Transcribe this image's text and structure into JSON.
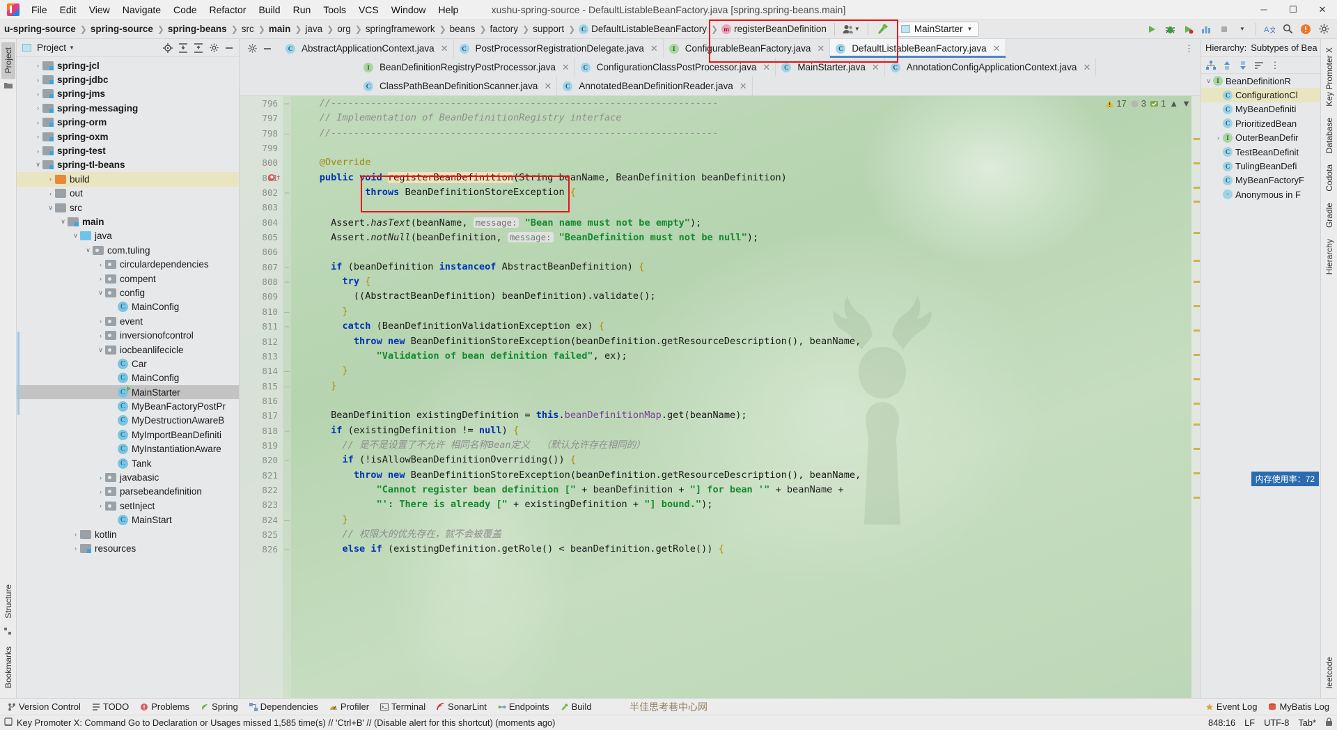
{
  "window": {
    "title": "xushu-spring-source - DefaultListableBeanFactory.java [spring.spring-beans.main]",
    "minimize": "─",
    "maximize": "☐",
    "close": "✕"
  },
  "menubar": [
    {
      "label": "File"
    },
    {
      "label": "Edit"
    },
    {
      "label": "View"
    },
    {
      "label": "Navigate"
    },
    {
      "label": "Code"
    },
    {
      "label": "Refactor"
    },
    {
      "label": "Build"
    },
    {
      "label": "Run"
    },
    {
      "label": "Tools"
    },
    {
      "label": "VCS"
    },
    {
      "label": "Window"
    },
    {
      "label": "Help"
    }
  ],
  "breadcrumbs": [
    {
      "label": "u-spring-source",
      "bold": true,
      "icon": null
    },
    {
      "label": "spring-source",
      "bold": true,
      "icon": null
    },
    {
      "label": "spring-beans",
      "bold": true,
      "icon": null
    },
    {
      "label": "src",
      "bold": false,
      "icon": null
    },
    {
      "label": "main",
      "bold": true,
      "icon": null
    },
    {
      "label": "java",
      "bold": false,
      "icon": null
    },
    {
      "label": "org",
      "bold": false,
      "icon": null
    },
    {
      "label": "springframework",
      "bold": false,
      "icon": null
    },
    {
      "label": "beans",
      "bold": false,
      "icon": null
    },
    {
      "label": "factory",
      "bold": false,
      "icon": null
    },
    {
      "label": "support",
      "bold": false,
      "icon": null
    },
    {
      "label": "DefaultListableBeanFactory",
      "bold": false,
      "icon": "class-icon",
      "iconletter": "C"
    },
    {
      "label": "registerBeanDefinition",
      "bold": false,
      "icon": "method-icon",
      "iconletter": "m"
    }
  ],
  "toolbar": {
    "avatar_icon": "user-group-icon",
    "hammer_icon": "build-hammer-icon",
    "run_config": "MainStarter",
    "run_icon": "run-config-icon",
    "right_icons": [
      "run-icon",
      "debug-icon",
      "coverage-icon",
      "profile-icon",
      "more-icon",
      "translate-icon",
      "search-icon",
      "updates-icon",
      "settings-icon"
    ]
  },
  "project_panel": {
    "tool_title": "Project",
    "vertical_tabs": [
      "Project",
      "Bookmarks",
      "Structure"
    ],
    "header_actions": [
      "locate-icon",
      "expand-all-icon",
      "collapse-all-icon",
      "settings-icon",
      "hide-icon"
    ],
    "tree": [
      {
        "depth": 1,
        "arrow": "›",
        "icon": "module-folder-icon",
        "label": "spring-jcl",
        "bold": true,
        "state": "none"
      },
      {
        "depth": 1,
        "arrow": "›",
        "icon": "module-folder-icon",
        "label": "spring-jdbc",
        "bold": true,
        "state": "none"
      },
      {
        "depth": 1,
        "arrow": "›",
        "icon": "module-folder-icon",
        "label": "spring-jms",
        "bold": true,
        "state": "none"
      },
      {
        "depth": 1,
        "arrow": "›",
        "icon": "module-folder-icon",
        "label": "spring-messaging",
        "bold": true,
        "state": "none"
      },
      {
        "depth": 1,
        "arrow": "›",
        "icon": "module-folder-icon",
        "label": "spring-orm",
        "bold": true,
        "state": "none"
      },
      {
        "depth": 1,
        "arrow": "›",
        "icon": "module-folder-icon",
        "label": "spring-oxm",
        "bold": true,
        "state": "none"
      },
      {
        "depth": 1,
        "arrow": "›",
        "icon": "module-folder-icon",
        "label": "spring-test",
        "bold": true,
        "state": "none"
      },
      {
        "depth": 1,
        "arrow": "∨",
        "icon": "module-folder-icon",
        "label": "spring-tl-beans",
        "bold": true,
        "state": "none"
      },
      {
        "depth": 2,
        "arrow": "›",
        "icon": "excluded-folder-icon",
        "label": "build",
        "bold": false,
        "state": "highlight"
      },
      {
        "depth": 2,
        "arrow": "›",
        "icon": "folder-icon",
        "label": "out",
        "bold": false,
        "state": "none"
      },
      {
        "depth": 2,
        "arrow": "∨",
        "icon": "folder-icon",
        "label": "src",
        "bold": false,
        "state": "none"
      },
      {
        "depth": 3,
        "arrow": "∨",
        "icon": "module-folder-icon",
        "label": "main",
        "bold": true,
        "state": "none"
      },
      {
        "depth": 4,
        "arrow": "∨",
        "icon": "source-folder-icon",
        "label": "java",
        "bold": false,
        "state": "none"
      },
      {
        "depth": 5,
        "arrow": "∨",
        "icon": "package-icon",
        "label": "com.tuling",
        "bold": false,
        "state": "none"
      },
      {
        "depth": 6,
        "arrow": "›",
        "icon": "package-icon",
        "label": "circulardependencies",
        "bold": false,
        "state": "none"
      },
      {
        "depth": 6,
        "arrow": "›",
        "icon": "package-icon",
        "label": "compent",
        "bold": false,
        "state": "none"
      },
      {
        "depth": 6,
        "arrow": "∨",
        "icon": "package-icon",
        "label": "config",
        "bold": false,
        "state": "none"
      },
      {
        "depth": 7,
        "arrow": "",
        "icon": "java-class-icon",
        "label": "MainConfig",
        "bold": false,
        "state": "none"
      },
      {
        "depth": 6,
        "arrow": "›",
        "icon": "package-icon",
        "label": "event",
        "bold": false,
        "state": "none"
      },
      {
        "depth": 6,
        "arrow": "›",
        "icon": "package-icon",
        "label": "inversionofcontrol",
        "bold": false,
        "state": "none"
      },
      {
        "depth": 6,
        "arrow": "∨",
        "icon": "package-icon",
        "label": "iocbeanlifecicle",
        "bold": false,
        "state": "none"
      },
      {
        "depth": 7,
        "arrow": "",
        "icon": "java-class-icon",
        "label": "Car",
        "bold": false,
        "state": "none"
      },
      {
        "depth": 7,
        "arrow": "",
        "icon": "java-class-icon",
        "label": "MainConfig",
        "bold": false,
        "state": "none"
      },
      {
        "depth": 7,
        "arrow": "",
        "icon": "java-runnable-class-icon",
        "label": "MainStarter",
        "bold": false,
        "state": "selected"
      },
      {
        "depth": 7,
        "arrow": "",
        "icon": "java-class-icon",
        "label": "MyBeanFactoryPostPr",
        "bold": false,
        "state": "none"
      },
      {
        "depth": 7,
        "arrow": "",
        "icon": "java-class-icon",
        "label": "MyDestructionAwareB",
        "bold": false,
        "state": "none"
      },
      {
        "depth": 7,
        "arrow": "",
        "icon": "java-class-icon",
        "label": "MyImportBeanDefiniti",
        "bold": false,
        "state": "none"
      },
      {
        "depth": 7,
        "arrow": "",
        "icon": "java-class-icon",
        "label": "MyInstantiationAware",
        "bold": false,
        "state": "none"
      },
      {
        "depth": 7,
        "arrow": "",
        "icon": "java-class-icon",
        "label": "Tank",
        "bold": false,
        "state": "none"
      },
      {
        "depth": 6,
        "arrow": "›",
        "icon": "package-icon",
        "label": "javabasic",
        "bold": false,
        "state": "none"
      },
      {
        "depth": 6,
        "arrow": "›",
        "icon": "package-icon",
        "label": "parsebeandefinition",
        "bold": false,
        "state": "none"
      },
      {
        "depth": 6,
        "arrow": "›",
        "icon": "package-icon",
        "label": "setInject",
        "bold": false,
        "state": "none"
      },
      {
        "depth": 7,
        "arrow": "",
        "icon": "java-class-icon",
        "label": "MainStart",
        "bold": false,
        "state": "none"
      },
      {
        "depth": 4,
        "arrow": "›",
        "icon": "folder-icon",
        "label": "kotlin",
        "bold": false,
        "state": "none"
      },
      {
        "depth": 4,
        "arrow": "›",
        "icon": "resources-folder-icon",
        "label": "resources",
        "bold": false,
        "state": "none"
      }
    ]
  },
  "editor": {
    "tab_rows": [
      [
        {
          "label": "AbstractApplicationContext.java",
          "icon": "class-icon",
          "kind": "class",
          "active": false
        },
        {
          "label": "PostProcessorRegistrationDelegate.java",
          "icon": "class-icon",
          "kind": "class",
          "active": false
        },
        {
          "label": "ConfigurableBeanFactory.java",
          "icon": "interface-icon",
          "kind": "interface",
          "active": false
        },
        {
          "label": "DefaultListableBeanFactory.java",
          "icon": "class-icon",
          "kind": "class",
          "active": true
        }
      ],
      [
        {
          "label": "BeanDefinitionRegistryPostProcessor.java",
          "icon": "interface-icon",
          "kind": "interface",
          "active": false
        },
        {
          "label": "ConfigurationClassPostProcessor.java",
          "icon": "class-icon",
          "kind": "class",
          "active": false
        },
        {
          "label": "MainStarter.java",
          "icon": "runnable-class-icon",
          "kind": "runnable",
          "active": false
        },
        {
          "label": "AnnotationConfigApplicationContext.java",
          "icon": "class-icon",
          "kind": "class",
          "active": false
        }
      ],
      [
        {
          "label": "ClassPathBeanDefinitionScanner.java",
          "icon": "class-icon",
          "kind": "class",
          "active": false
        },
        {
          "label": "AnnotatedBeanDefinitionReader.java",
          "icon": "class-icon",
          "kind": "class",
          "active": false
        }
      ]
    ],
    "inspection": {
      "warning_icon": "warning-triangle-icon",
      "warning_count": "17",
      "weak_icon": "weak-warning-icon",
      "weak_count": "3",
      "ok_icon": "server-check-icon",
      "ok_count": "1",
      "up_icon": "chevron-up-icon",
      "down_icon": "chevron-down-icon"
    },
    "first_line_number": 796,
    "lines": [
      {
        "n": 796,
        "html": "<span class=\"cm\">//--------------------------------------------------------------------</span>",
        "indent": 1,
        "fold": "start"
      },
      {
        "n": 797,
        "html": "<span class=\"cm\">// Implementation of BeanDefinitionRegistry interface</span>",
        "indent": 1,
        "fold": "mid"
      },
      {
        "n": 798,
        "html": "<span class=\"cm\">//--------------------------------------------------------------------</span>",
        "indent": 1,
        "fold": "end"
      },
      {
        "n": 799,
        "html": "",
        "indent": 0,
        "fold": "none"
      },
      {
        "n": 800,
        "html": "<span class=\"an\">@Override</span>",
        "indent": 1,
        "fold": "none"
      },
      {
        "n": 801,
        "html": "<span class=\"k\">public void</span> <span class=\"ident-hl\">registerBeanDefinition</span>(String beanName, BeanDefinition beanDefinition)",
        "indent": 1,
        "fold": "none",
        "marker": "breakpoint-override"
      },
      {
        "n": 802,
        "html": "        <span class=\"k\">throws</span> BeanDefinitionStoreException <span class=\"br\">{</span>",
        "indent": 1,
        "fold": "start"
      },
      {
        "n": 803,
        "html": "",
        "indent": 0,
        "fold": "none"
      },
      {
        "n": 804,
        "html": "  Assert.<span class=\"fi\">hasText</span>(beanName, <span class=\"hint\">message:</span> <span class=\"s\">\"Bean name must not be empty\"</span>);",
        "indent": 1,
        "fold": "none"
      },
      {
        "n": 805,
        "html": "  Assert.<span class=\"fi\">notNull</span>(beanDefinition, <span class=\"hint\">message:</span> <span class=\"s\">\"BeanDefinition must not be null\"</span>);",
        "indent": 1,
        "fold": "none"
      },
      {
        "n": 806,
        "html": "",
        "indent": 0,
        "fold": "none"
      },
      {
        "n": 807,
        "html": "  <span class=\"k\">if</span> (beanDefinition <span class=\"k\">instanceof</span> AbstractBeanDefinition) <span class=\"br\">{</span>",
        "indent": 1,
        "fold": "start"
      },
      {
        "n": 808,
        "html": "    <span class=\"k\">try</span> <span class=\"br\">{</span>",
        "indent": 2,
        "fold": "start"
      },
      {
        "n": 809,
        "html": "      ((AbstractBeanDefinition) beanDefinition).validate();",
        "indent": 3,
        "fold": "none"
      },
      {
        "n": 810,
        "html": "    <span class=\"br\">}</span>",
        "indent": 2,
        "fold": "end"
      },
      {
        "n": 811,
        "html": "    <span class=\"k\">catch</span> (BeanDefinitionValidationException ex) <span class=\"br\">{</span>",
        "indent": 2,
        "fold": "start"
      },
      {
        "n": 812,
        "html": "      <span class=\"k\">throw new</span> BeanDefinitionStoreException(beanDefinition.getResourceDescription(), beanName,",
        "indent": 3,
        "fold": "none"
      },
      {
        "n": 813,
        "html": "          <span class=\"s\">\"Validation of bean definition failed\"</span>, ex);",
        "indent": 4,
        "fold": "none"
      },
      {
        "n": 814,
        "html": "    <span class=\"br\">}</span>",
        "indent": 2,
        "fold": "end"
      },
      {
        "n": 815,
        "html": "  <span class=\"br\">}</span>",
        "indent": 1,
        "fold": "end"
      },
      {
        "n": 816,
        "html": "",
        "indent": 0,
        "fold": "none"
      },
      {
        "n": 817,
        "html": "  BeanDefinition existingDefinition = <span class=\"k\">this</span>.<span class=\"fd\">beanDefinitionMap</span>.get(beanName);",
        "indent": 1,
        "fold": "none"
      },
      {
        "n": 818,
        "html": "  <span class=\"k\">if</span> (existingDefinition != <span class=\"k\">null</span>) <span class=\"br\">{</span>",
        "indent": 1,
        "fold": "start"
      },
      {
        "n": 819,
        "html": "    <span class=\"cm\">// 是不是设置了不允许 相同名称Bean定义  （默认允许存在相同的）</span>",
        "indent": 2,
        "fold": "none"
      },
      {
        "n": 820,
        "html": "    <span class=\"k\">if</span> (!isAllowBeanDefinitionOverriding()) <span class=\"br\">{</span>",
        "indent": 2,
        "fold": "start"
      },
      {
        "n": 821,
        "html": "      <span class=\"k\">throw new</span> BeanDefinitionStoreException(beanDefinition.getResourceDescription(), beanName,",
        "indent": 3,
        "fold": "none"
      },
      {
        "n": 822,
        "html": "          <span class=\"s\">\"Cannot register bean definition [\"</span> + beanDefinition + <span class=\"s\">\"] for bean '\"</span> + beanName +",
        "indent": 4,
        "fold": "none"
      },
      {
        "n": 823,
        "html": "          <span class=\"s\">\"': There is already [\"</span> + existingDefinition + <span class=\"s\">\"] bound.\"</span>);",
        "indent": 4,
        "fold": "none"
      },
      {
        "n": 824,
        "html": "    <span class=\"br\">}</span>",
        "indent": 2,
        "fold": "end"
      },
      {
        "n": 825,
        "html": "    <span class=\"cm\">// 权限大的优先存在，就不会被覆盖</span>",
        "indent": 2,
        "fold": "none"
      },
      {
        "n": 826,
        "html": "    <span class=\"k\">else if</span> (existingDefinition.getRole() &lt; beanDefinition.getRole()) <span class=\"br\">{</span>",
        "indent": 2,
        "fold": "start"
      }
    ]
  },
  "hierarchy": {
    "label": "Hierarchy:",
    "dropdown": "Subtypes of Bea",
    "tools": [
      "class-hierarchy-icon",
      "supertypes-icon",
      "subtypes-icon",
      "sort-icon",
      "more-icon"
    ],
    "rows": [
      {
        "depth": 0,
        "arrow": "∨",
        "icon": "interface-icon",
        "letter": "I",
        "label": "BeanDefinitionR",
        "hl": false
      },
      {
        "depth": 1,
        "arrow": "",
        "icon": "class-icon",
        "letter": "C",
        "label": "ConfigurationCl",
        "hl": true
      },
      {
        "depth": 1,
        "arrow": "",
        "icon": "class-icon",
        "letter": "C",
        "label": "MyBeanDefiniti",
        "hl": false
      },
      {
        "depth": 1,
        "arrow": "",
        "icon": "class-icon",
        "letter": "C",
        "label": "PrioritizedBean",
        "hl": false
      },
      {
        "depth": 1,
        "arrow": "›",
        "icon": "interface-icon",
        "letter": "I",
        "label": "OuterBeanDefir",
        "hl": false
      },
      {
        "depth": 1,
        "arrow": "",
        "icon": "class-icon",
        "letter": "C",
        "label": "TestBeanDefinit",
        "hl": false
      },
      {
        "depth": 1,
        "arrow": "",
        "icon": "class-icon",
        "letter": "C",
        "label": "TulingBeanDefi",
        "hl": false
      },
      {
        "depth": 1,
        "arrow": "",
        "icon": "class-icon",
        "letter": "C",
        "label": "MyBeanFactoryF",
        "hl": false
      },
      {
        "depth": 1,
        "arrow": "",
        "icon": "anonymous-icon",
        "letter": "·",
        "label": "Anonymous in F",
        "hl": false
      }
    ],
    "right_tabs": [
      "Key Promoter X",
      "Database",
      "Codota",
      "Gradle",
      "Hierarchy",
      "leetcode"
    ]
  },
  "bottom_toolwindows": {
    "left": [
      {
        "label": "Version Control",
        "icon": "branch-icon"
      },
      {
        "label": "TODO",
        "icon": "todo-icon"
      },
      {
        "label": "Problems",
        "icon": "problems-icon"
      },
      {
        "label": "Spring",
        "icon": "spring-leaf-icon"
      },
      {
        "label": "Dependencies",
        "icon": "dependencies-icon"
      },
      {
        "label": "Profiler",
        "icon": "profiler-icon"
      },
      {
        "label": "Terminal",
        "icon": "terminal-icon"
      },
      {
        "label": "SonarLint",
        "icon": "sonarlint-icon"
      },
      {
        "label": "Endpoints",
        "icon": "endpoints-icon"
      },
      {
        "label": "Build",
        "icon": "build-icon"
      }
    ],
    "right": [
      {
        "label": "Event Log",
        "icon": "event-log-icon"
      },
      {
        "label": "MyBatis Log",
        "icon": "mybatis-icon"
      }
    ]
  },
  "statusbar": {
    "icon": "notification-icon",
    "message": "Key Promoter X: Command Go to Declaration or Usages missed 1,585 time(s) // 'Ctrl+B' // (Disable alert for this shortcut) (moments ago)",
    "caret": "848:16",
    "line_sep": "LF",
    "encoding": "UTF-8",
    "indent": "Tab*",
    "lock_icon": "lock-icon"
  },
  "overlays": {
    "memory_indicator": "内存使用率：72",
    "watermark": "半佳思考巷中心网"
  },
  "colors": {
    "accent_red": "#ee1111",
    "editor_bg": "#bcd7b7",
    "tab_active_underline": "#4a86c8",
    "selection": "#c3c3c3",
    "highlight": "#e8e5c0"
  }
}
